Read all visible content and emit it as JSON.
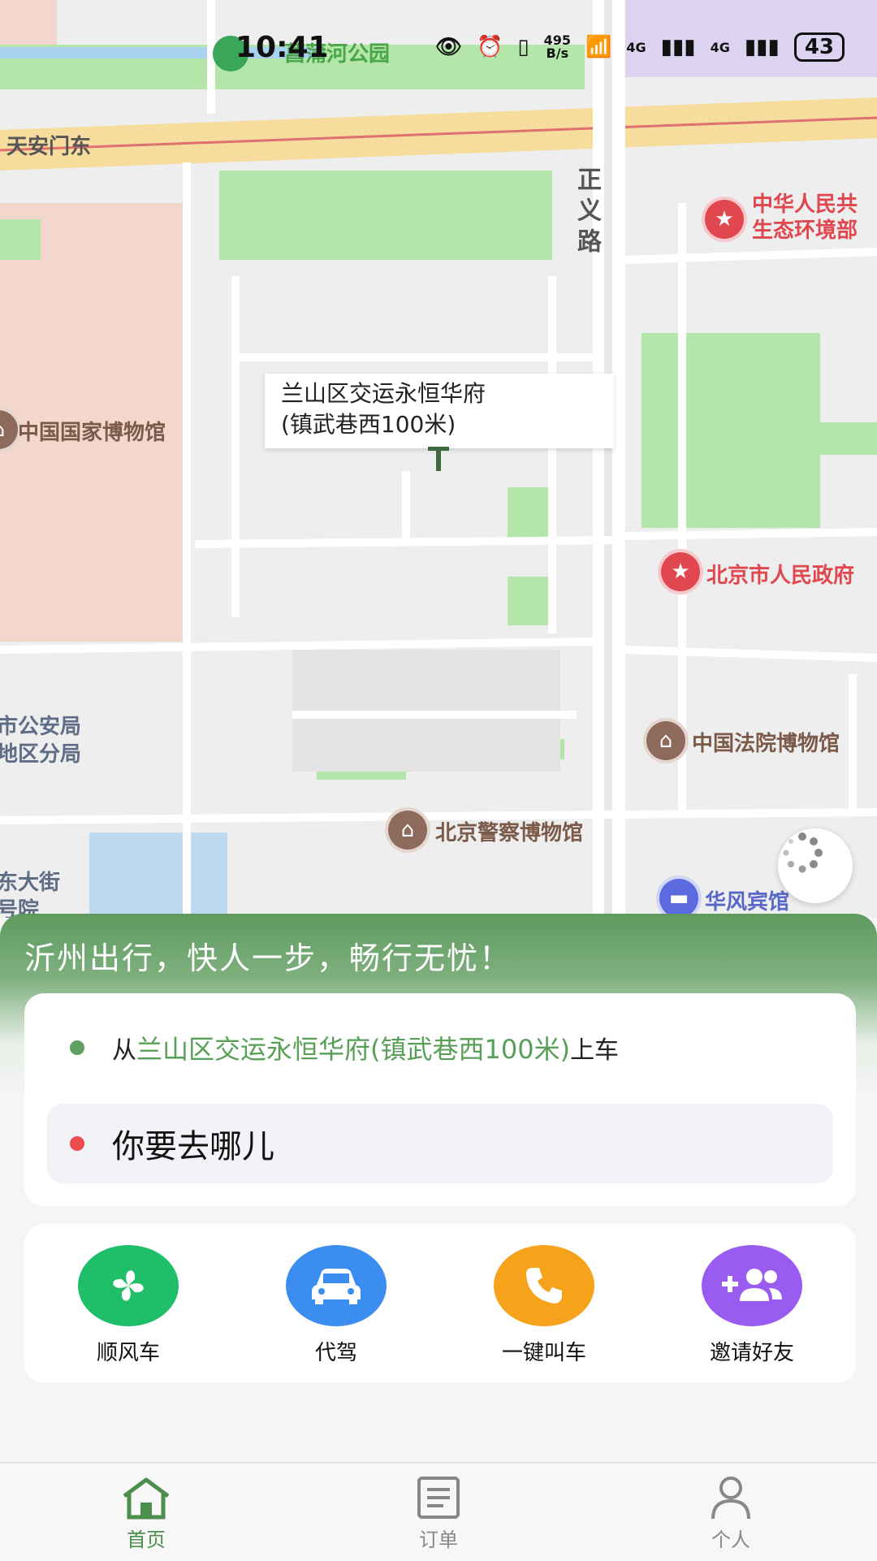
{
  "status_bar": {
    "time": "10:41",
    "net_speed": "495\nB/s",
    "battery": "43",
    "net1": "4G",
    "net2": "4G"
  },
  "map": {
    "callout": "兰山区交运永恒华府\n(镇武巷西100米)",
    "road_vertical": "正义路",
    "road_top": "天安门东",
    "park_label": "菖蒲河公园",
    "pois": [
      {
        "label": "中华人民共\n生态环境部",
        "kind": "red"
      },
      {
        "label": "中国国家博物馆",
        "kind": "brown"
      },
      {
        "label": "北京市人民政府",
        "kind": "red"
      },
      {
        "label": "中国法院博物馆",
        "kind": "brown"
      },
      {
        "label": "北京警察博物馆",
        "kind": "brown"
      },
      {
        "label": "华风宾馆",
        "kind": "blue"
      },
      {
        "label": "市公安局\n地区分局",
        "kind": "gray"
      },
      {
        "label": "东大街\n号院",
        "kind": "gray"
      }
    ]
  },
  "sheet": {
    "slogan": "沂州出行，快人一步，畅行无忧！",
    "from_prefix": "从",
    "from_place": "兰山区交运永恒华府(镇武巷西100米)",
    "from_suffix": "上车",
    "to_placeholder": "你要去哪儿",
    "services": [
      {
        "label": "顺风车",
        "color": "#1fbf6a",
        "icon": "pinwheel-icon"
      },
      {
        "label": "代驾",
        "color": "#3b8ef0",
        "icon": "car-icon"
      },
      {
        "label": "一键叫车",
        "color": "#f7a21b",
        "icon": "phone-icon"
      },
      {
        "label": "邀请好友",
        "color": "#9a5cf0",
        "icon": "add-friend-icon"
      }
    ]
  },
  "tabs": [
    {
      "label": "首页",
      "icon": "home-icon",
      "active": true
    },
    {
      "label": "订单",
      "icon": "orders-icon",
      "active": false
    },
    {
      "label": "个人",
      "icon": "person-icon",
      "active": false
    }
  ],
  "colors": {
    "accent_green": "#4c8f4c",
    "map_road": "#ffffff",
    "map_green": "#b3e6a8"
  }
}
